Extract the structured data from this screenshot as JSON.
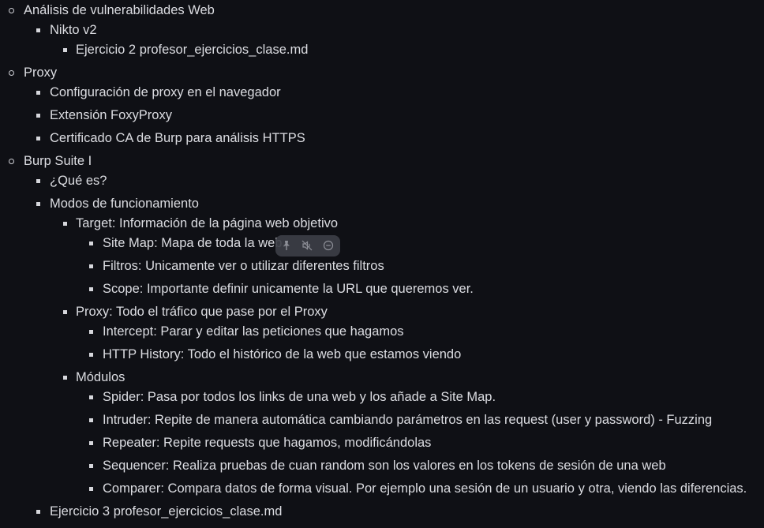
{
  "outline": [
    {
      "level": 0,
      "text": "Análisis de vulnerabilidades Web"
    },
    {
      "level": 1,
      "text": "Nikto v2"
    },
    {
      "level": 2,
      "text": "Ejercicio 2 profesor_ejercicios_clase.md"
    },
    {
      "level": 0,
      "text": "Proxy"
    },
    {
      "level": 1,
      "text": "Configuración de proxy en el navegador"
    },
    {
      "level": 1,
      "text": "Extensión FoxyProxy"
    },
    {
      "level": 1,
      "text": "Certificado CA de Burp para análisis HTTPS"
    },
    {
      "level": 0,
      "text": "Burp Suite I"
    },
    {
      "level": 1,
      "text": "¿Qué es?"
    },
    {
      "level": 1,
      "text": "Modos de funcionamiento"
    },
    {
      "level": 2,
      "text": "Target: Información de la página web objetivo"
    },
    {
      "level": 3,
      "text": "Site Map: Mapa de toda la web."
    },
    {
      "level": 3,
      "text": "Filtros: Unicamente ver o utilizar diferentes filtros"
    },
    {
      "level": 3,
      "text": "Scope: Importante definir unicamente la URL que queremos ver."
    },
    {
      "level": 2,
      "text": "Proxy: Todo el tráfico que pase por el Proxy"
    },
    {
      "level": 3,
      "text": "Intercept: Parar y editar las peticiones que hagamos"
    },
    {
      "level": 3,
      "text": "HTTP History: Todo el histórico de la web que estamos viendo"
    },
    {
      "level": 2,
      "text": "Módulos"
    },
    {
      "level": 3,
      "text": "Spider: Pasa por todos los links de una web y los añade a Site Map."
    },
    {
      "level": 3,
      "text": "Intruder: Repite de manera automática cambiando parámetros en las request (user y password) - Fuzzing"
    },
    {
      "level": 3,
      "text": "Repeater: Repite requests que hagamos, modificándolas"
    },
    {
      "level": 3,
      "text": "Sequencer: Realiza pruebas de cuan random son los valores en los tokens de sesión de una web"
    },
    {
      "level": 3,
      "text": "Comparer: Compara datos de forma visual. Por ejemplo una sesión de un usuario y otra, viendo las diferencias."
    },
    {
      "level": 1,
      "text": "Ejercicio 3 profesor_ejercicios_clase.md"
    }
  ],
  "toolbar": {
    "icons": [
      "pin-icon",
      "mute-icon",
      "minus-circle-icon"
    ]
  },
  "colors": {
    "background": "#0f1015",
    "text": "#dcdde2",
    "toolbar": "#3c3e46"
  }
}
